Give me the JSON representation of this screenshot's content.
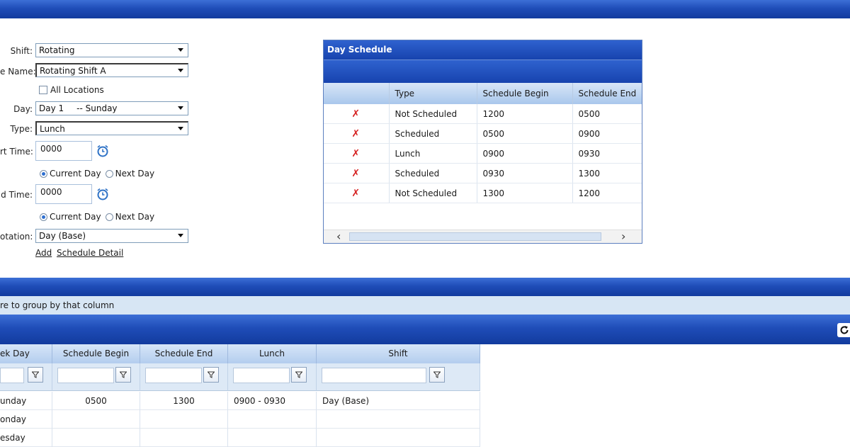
{
  "form": {
    "shift": {
      "label": "Shift:",
      "value": "Rotating"
    },
    "schedule_name": {
      "label": "e Name:",
      "value": "Rotating Shift A"
    },
    "all_locations": {
      "label": "All Locations"
    },
    "day": {
      "label": "Day:",
      "value": "Day 1",
      "value_extra": "-- Sunday"
    },
    "type": {
      "label": "Type:",
      "value": "Lunch"
    },
    "start_time": {
      "label": "rt Time:",
      "value": "0000"
    },
    "start_radio": {
      "current": "Current Day",
      "next": "Next Day"
    },
    "end_time": {
      "label": "d Time:",
      "value": "0000"
    },
    "end_radio": {
      "current": "Current Day",
      "next": "Next Day"
    },
    "rotation": {
      "label": "otation:",
      "value": "Day (Base)"
    },
    "add_link": "Add",
    "schedule_detail_link": "Schedule Detail"
  },
  "day_schedule": {
    "title": "Day Schedule",
    "columns": [
      "",
      "Type",
      "Schedule Begin",
      "Schedule End"
    ],
    "rows": [
      {
        "type": "Not Scheduled",
        "begin": "1200",
        "end": "0500"
      },
      {
        "type": "Scheduled",
        "begin": "0500",
        "end": "0900"
      },
      {
        "type": "Lunch",
        "begin": "0900",
        "end": "0930"
      },
      {
        "type": "Scheduled",
        "begin": "0930",
        "end": "1300"
      },
      {
        "type": "Not Scheduled",
        "begin": "1300",
        "end": "1200"
      }
    ],
    "scroll_left": "‹",
    "scroll_right": "›"
  },
  "grid": {
    "group_hint": "re to group by that column",
    "columns": [
      "ek Day",
      "Schedule Begin",
      "Schedule End",
      "Lunch",
      "Shift"
    ],
    "rows": [
      {
        "day": "unday",
        "begin": "0500",
        "end": "1300",
        "lunch": "0900 - 0930",
        "shift": "Day (Base)"
      },
      {
        "day": "onday",
        "begin": "",
        "end": "",
        "lunch": "",
        "shift": ""
      },
      {
        "day": "esday",
        "begin": "",
        "end": "",
        "lunch": "",
        "shift": ""
      }
    ]
  },
  "colors": {
    "header_blue": "#1f4db8",
    "delete_red": "#d52020",
    "grid_header": "#b3cdee"
  }
}
